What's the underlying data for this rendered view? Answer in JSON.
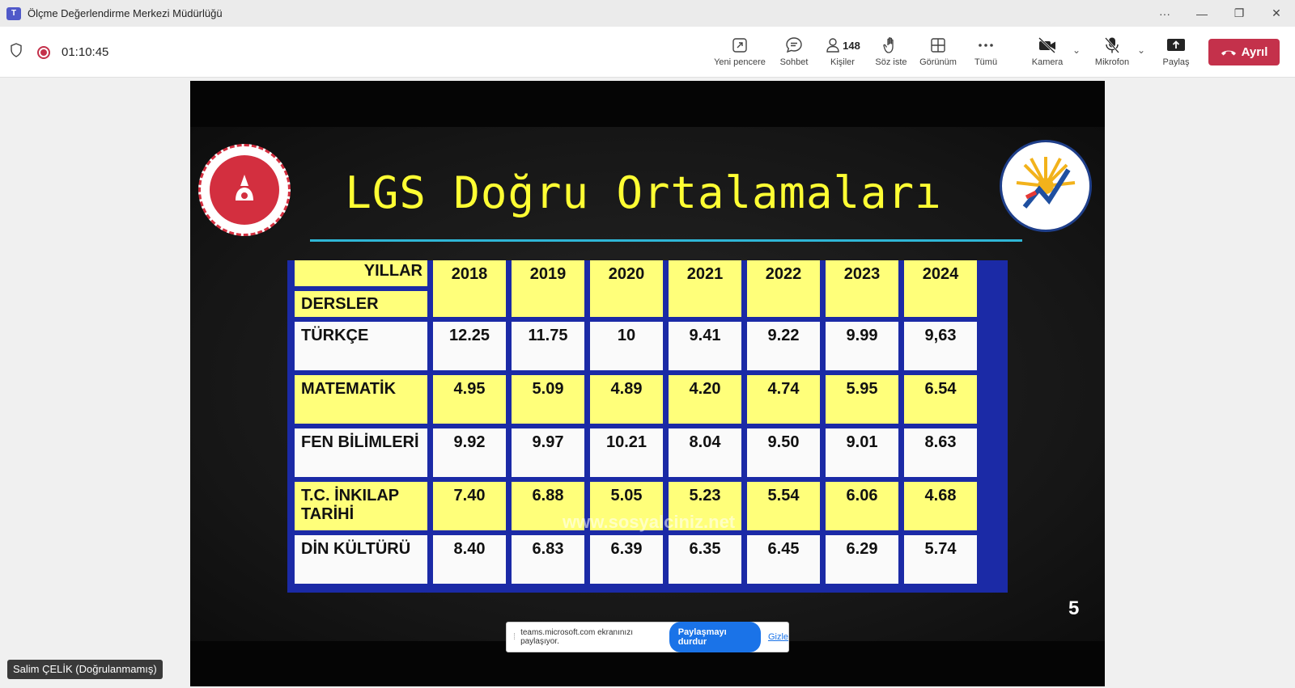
{
  "window": {
    "title": "Ölçme Değerlendirme Merkezi Müdürlüğü",
    "app_icon": "teams-icon"
  },
  "toolbar": {
    "timer": "01:10:45",
    "items": [
      {
        "label": "Yeni pencere",
        "icon": "new-window-icon"
      },
      {
        "label": "Sohbet",
        "icon": "chat-icon"
      },
      {
        "label": "Kişiler",
        "icon": "people-icon",
        "count": "148"
      },
      {
        "label": "Söz iste",
        "icon": "raise-hand-icon"
      },
      {
        "label": "Görünüm",
        "icon": "view-grid-icon"
      },
      {
        "label": "Tümü",
        "icon": "more-icon"
      },
      {
        "label": "Kamera",
        "icon": "camera-off-icon"
      },
      {
        "label": "Mikrofon",
        "icon": "mic-off-icon"
      },
      {
        "label": "Paylaş",
        "icon": "share-icon"
      }
    ],
    "leave_label": "Ayrıl",
    "leave_color": "#c4314b"
  },
  "slide": {
    "title": "LGS Doğru Ortalamaları",
    "page_number": "5",
    "watermark": "www.sosyalciniz.net",
    "table": {
      "corner_top": "YILLAR",
      "corner_bottom": "DERSLER",
      "years": [
        "2018",
        "2019",
        "2020",
        "2021",
        "2022",
        "2023",
        "2024"
      ],
      "rows": [
        {
          "subject": "TÜRKÇE",
          "values": [
            "12.25",
            "11.75",
            "10",
            "9.41",
            "9.22",
            "9.99",
            "9,63"
          ]
        },
        {
          "subject": "MATEMATİK",
          "values": [
            "4.95",
            "5.09",
            "4.89",
            "4.20",
            "4.74",
            "5.95",
            "6.54"
          ]
        },
        {
          "subject": "FEN BİLİMLERİ",
          "values": [
            "9.92",
            "9.97",
            "10.21",
            "8.04",
            "9.50",
            "9.01",
            "8.63"
          ]
        },
        {
          "subject": "T.C. İNKILAP TARİHİ",
          "values": [
            "7.40",
            "6.88",
            "5.05",
            "5.23",
            "5.54",
            "6.06",
            "4.68"
          ]
        },
        {
          "subject": "DİN KÜLTÜRÜ",
          "values": [
            "8.40",
            "6.83",
            "6.39",
            "6.35",
            "6.45",
            "6.29",
            "5.74"
          ]
        }
      ]
    },
    "colors": {
      "title": "#ffff33",
      "table_border": "#1b2aa6",
      "cell_yellow": "#ffff7a"
    }
  },
  "sharebar": {
    "message": "teams.microsoft.com ekranınızı paylaşıyor.",
    "stop_label": "Paylaşmayı durdur",
    "hide_label": "Gizle"
  },
  "participant": {
    "name": "Salim ÇELİK (Doğrulanmamış)"
  }
}
